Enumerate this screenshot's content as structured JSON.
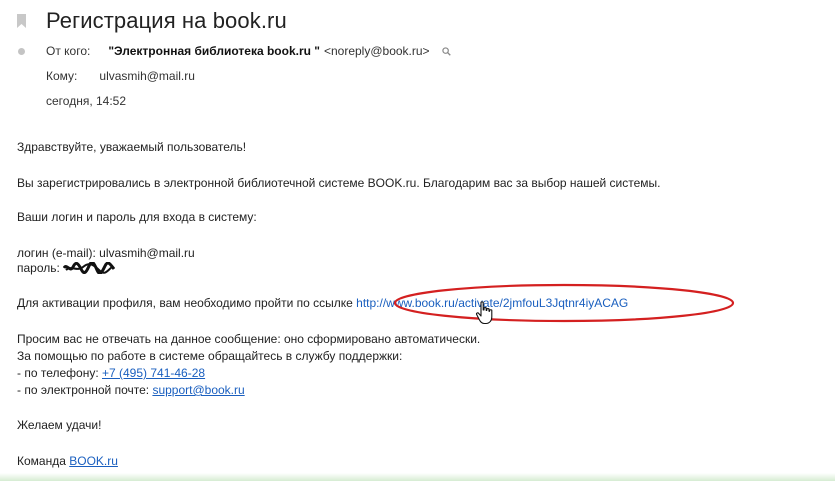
{
  "email": {
    "subject": "Регистрация на book.ru",
    "from_label": "От кого:",
    "from_name": "\"Электронная библиотека book.ru \"",
    "from_address": "<noreply@book.ru>",
    "to_label": "Кому:",
    "to_value": "ulvasmih@mail.ru",
    "date": "сегодня, 14:52"
  },
  "body": {
    "greeting": "Здравствуйте, уважаемый пользователь!",
    "registered": "Вы зарегистрировались в электронной библиотечной системе BOOK.ru. Благодарим вас за выбор нашей системы.",
    "credentials_intro": "Ваши логин и пароль для входа в систему:",
    "login_line": "логин (e-mail): ulvasmih@mail.ru",
    "password_label": "пароль:",
    "activation_text": "Для активации профиля, вам необходимо пройти по ссылке",
    "activation_link": "http://www.book.ru/activate/2jmfouL3Jqtnr4iyACAG",
    "no_reply": "Просим вас не отвечать на данное сообщение: оно сформировано автоматически.",
    "support_intro": "За помощью по работе в системе обращайтесь в службу поддержки:",
    "phone_label": "- по телефону:",
    "phone": "+7 (495) 741-46-28",
    "email_label": "- по электронной почте:",
    "support_email": "support@book.ru",
    "wishes": "Желаем удачи!",
    "team_label": "Команда",
    "team_link": "BOOK.ru"
  },
  "colors": {
    "link": "#1a5fbf",
    "highlight_oval": "#d42020",
    "frame": "#d6ecd2"
  },
  "icons": {
    "bookmark": "bookmark-icon",
    "status": "dot-icon",
    "search": "search-icon",
    "cursor": "hand-cursor-icon"
  }
}
